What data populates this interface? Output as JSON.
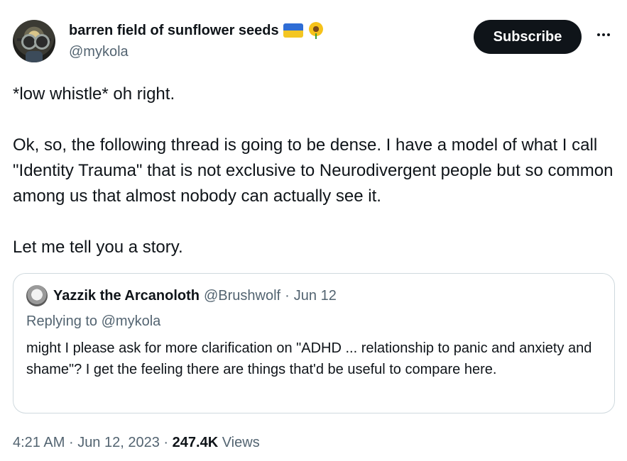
{
  "author": {
    "display_name": "barren field of sunflower seeds",
    "handle": "@mykola",
    "flag_icon": "ukraine-flag-icon",
    "emoji_icon": "sunflower-icon"
  },
  "actions": {
    "subscribe_label": "Subscribe",
    "more_icon": "ellipsis-icon"
  },
  "tweet": {
    "paragraphs": [
      "*low whistle* oh right.",
      "Ok, so, the following thread is going to be dense. I have a model of what I call \"Identity Trauma\" that is not exclusive to Neurodivergent people but so common among us that almost nobody can actually see it.",
      "Let me tell you a story."
    ]
  },
  "quote": {
    "display_name": "Yazzik the Arcanoloth",
    "handle": "@Brushwolf",
    "separator": "·",
    "date": "Jun 12",
    "replying_to": "Replying to @mykola",
    "text": "might I please ask for more clarification on \"ADHD ... relationship to panic and anxiety and shame\"? I get the feeling there are things that'd be useful to compare here."
  },
  "footer": {
    "time": "4:21 AM",
    "separator": "·",
    "date": "Jun 12, 2023",
    "views_count": "247.4K",
    "views_label": "Views"
  },
  "colors": {
    "text": "#0f1419",
    "muted": "#536471",
    "border": "#cfd9de",
    "button_bg": "#0f1419"
  }
}
